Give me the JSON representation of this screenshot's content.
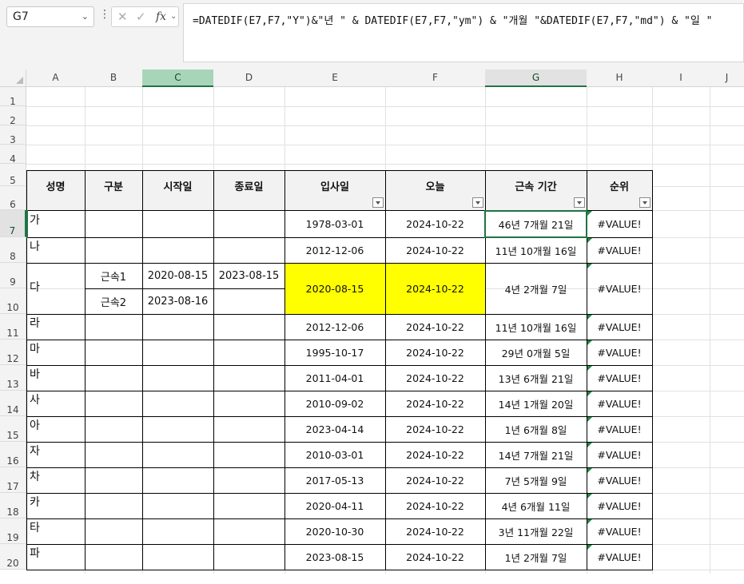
{
  "toolbar": {
    "name_box": "G7",
    "fx_label": "fx",
    "formula": "=DATEDIF(E7,F7,\"Y\")&\"년 \" & DATEDIF(E7,F7,\"ym\") & \"개월 \"&DATEDIF(E7,F7,\"md\") & \"일 \""
  },
  "columns": [
    "A",
    "B",
    "C",
    "D",
    "E",
    "F",
    "G",
    "H",
    "I",
    "J"
  ],
  "rows": [
    "1",
    "2",
    "3",
    "4",
    "5",
    "6",
    "7",
    "8",
    "9",
    "10",
    "11",
    "12",
    "13",
    "14",
    "15",
    "16",
    "17",
    "18",
    "19",
    "20"
  ],
  "headers": {
    "name": "성명",
    "type": "구분",
    "start": "시작일",
    "end": "종료일",
    "hire": "입사일",
    "today": "오늘",
    "tenure": "근속 기간",
    "rank": "순위"
  },
  "merged_row": {
    "name": "다",
    "sub1": {
      "type": "근속1",
      "start": "2020-08-15",
      "end": "2023-08-15"
    },
    "sub2": {
      "type": "근속2",
      "start": "2023-08-16"
    },
    "hire": "2020-08-15",
    "today": "2024-10-22",
    "tenure": "4년 2개월 7일",
    "rank": "#VALUE!"
  },
  "table_rows": [
    {
      "name": "가",
      "hire": "1978-03-01",
      "today": "2024-10-22",
      "tenure": "46년 7개월 21일",
      "rank": "#VALUE!"
    },
    {
      "name": "나",
      "hire": "2012-12-06",
      "today": "2024-10-22",
      "tenure": "11년 10개월 16일",
      "rank": "#VALUE!"
    },
    {
      "name": "라",
      "hire": "2012-12-06",
      "today": "2024-10-22",
      "tenure": "11년 10개월 16일",
      "rank": "#VALUE!"
    },
    {
      "name": "마",
      "hire": "1995-10-17",
      "today": "2024-10-22",
      "tenure": "29년 0개월 5일",
      "rank": "#VALUE!"
    },
    {
      "name": "바",
      "hire": "2011-04-01",
      "today": "2024-10-22",
      "tenure": "13년 6개월 21일",
      "rank": "#VALUE!"
    },
    {
      "name": "사",
      "hire": "2010-09-02",
      "today": "2024-10-22",
      "tenure": "14년 1개월 20일",
      "rank": "#VALUE!"
    },
    {
      "name": "아",
      "hire": "2023-04-14",
      "today": "2024-10-22",
      "tenure": "1년 6개월 8일",
      "rank": "#VALUE!"
    },
    {
      "name": "자",
      "hire": "2010-03-01",
      "today": "2024-10-22",
      "tenure": "14년 7개월 21일",
      "rank": "#VALUE!"
    },
    {
      "name": "차",
      "hire": "2017-05-13",
      "today": "2024-10-22",
      "tenure": "7년 5개월 9일",
      "rank": "#VALUE!"
    },
    {
      "name": "카",
      "hire": "2020-04-11",
      "today": "2024-10-22",
      "tenure": "4년 6개월 11일",
      "rank": "#VALUE!"
    },
    {
      "name": "타",
      "hire": "2020-10-30",
      "today": "2024-10-22",
      "tenure": "3년 11개월 22일",
      "rank": "#VALUE!"
    },
    {
      "name": "파",
      "hire": "2023-08-15",
      "today": "2024-10-22",
      "tenure": "1년 2개월 7일",
      "rank": "#VALUE!"
    }
  ],
  "colors": {
    "accent": "#217346",
    "highlight": "#ffff00",
    "error_triangle": "#1e8a3e"
  }
}
